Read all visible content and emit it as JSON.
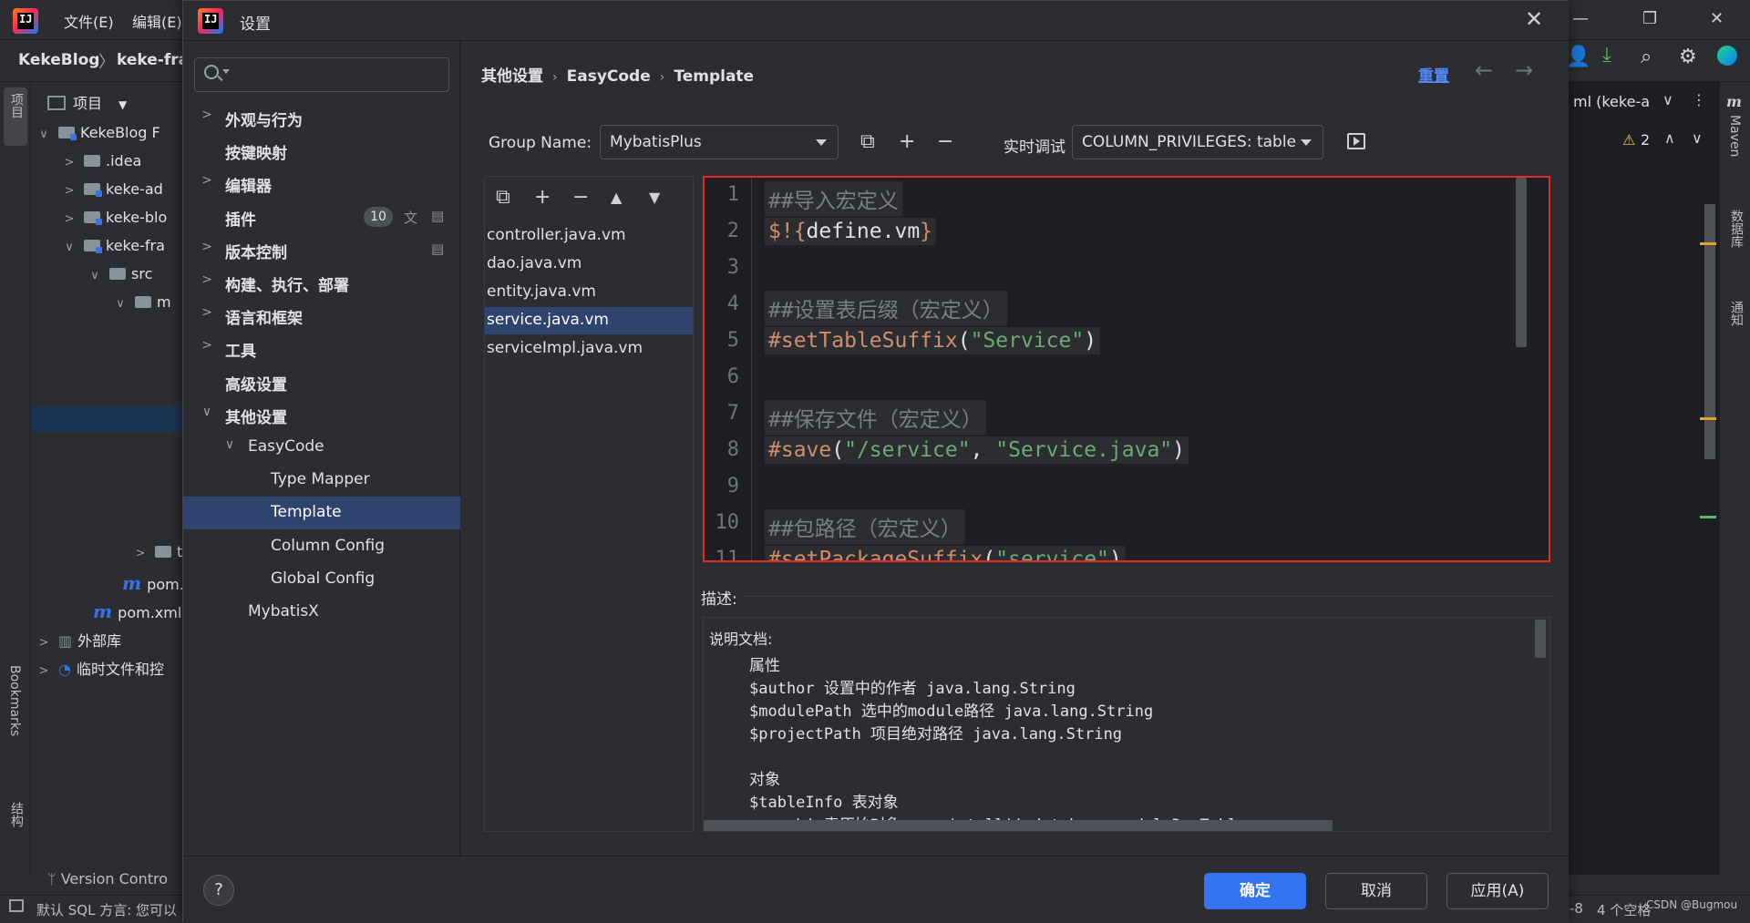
{
  "ide": {
    "menu": [
      "文件(E)",
      "编辑(E)"
    ],
    "breadcrumb": [
      "KekeBlog",
      "keke-fra"
    ],
    "project_label": "项目",
    "tree": [
      {
        "label": "KekeBlog F",
        "indent": 0,
        "type": "mod",
        "chev": "∨"
      },
      {
        "label": ".idea",
        "indent": 1,
        "type": "folder",
        "chev": ">"
      },
      {
        "label": "keke-ad",
        "indent": 1,
        "type": "mod",
        "chev": ">"
      },
      {
        "label": "keke-blo",
        "indent": 1,
        "type": "mod",
        "chev": ">"
      },
      {
        "label": "keke-fra",
        "indent": 1,
        "type": "mod",
        "chev": "∨"
      },
      {
        "label": "src",
        "indent": 2,
        "type": "folder",
        "chev": "∨"
      },
      {
        "label": "m",
        "indent": 3,
        "type": "folder",
        "chev": "∨"
      }
    ],
    "tree_bottom": [
      {
        "label": "te",
        "type": "folder"
      },
      {
        "label": "pom.",
        "type": "m"
      },
      {
        "label": "pom.xml",
        "type": "m"
      },
      {
        "label": "外部库",
        "type": "lib"
      },
      {
        "label": "临时文件和控",
        "type": "tmp"
      }
    ],
    "left_stripe": [
      "项目",
      "Bookmarks",
      "结构"
    ],
    "right_stripe": [
      "Maven",
      "数据库",
      "通知"
    ],
    "right_tab": "ml (keke-a",
    "warnings": "2",
    "bottom_tool": "Version Contro",
    "status_left": "默认 SQL 方言: 您可以",
    "status_right": [
      "-8",
      "4 个空格"
    ],
    "watermark": "CSDN @Bugmou"
  },
  "dialog": {
    "title": "设置",
    "nav": {
      "search_placeholder": "",
      "items": [
        {
          "label": "外观与行为",
          "level": 0,
          "chev": ">",
          "bold": true
        },
        {
          "label": "按键映射",
          "level": 0,
          "chev": "",
          "bold": true
        },
        {
          "label": "编辑器",
          "level": 0,
          "chev": ">",
          "bold": true
        },
        {
          "label": "插件",
          "level": 0,
          "chev": "",
          "bold": true,
          "badge": "10"
        },
        {
          "label": "版本控制",
          "level": 0,
          "chev": ">",
          "bold": true
        },
        {
          "label": "构建、执行、部署",
          "level": 0,
          "chev": ">",
          "bold": true
        },
        {
          "label": "语言和框架",
          "level": 0,
          "chev": ">",
          "bold": true
        },
        {
          "label": "工具",
          "level": 0,
          "chev": ">",
          "bold": true
        },
        {
          "label": "高级设置",
          "level": 0,
          "chev": "",
          "bold": true
        },
        {
          "label": "其他设置",
          "level": 0,
          "chev": "∨",
          "bold": true
        },
        {
          "label": "EasyCode",
          "level": 1,
          "chev": "∨",
          "bold": false
        },
        {
          "label": "Type Mapper",
          "level": 2,
          "chev": "",
          "bold": false
        },
        {
          "label": "Template",
          "level": 2,
          "chev": "",
          "bold": false,
          "selected": true
        },
        {
          "label": "Column Config",
          "level": 2,
          "chev": "",
          "bold": false
        },
        {
          "label": "Global Config",
          "level": 2,
          "chev": "",
          "bold": false
        },
        {
          "label": "MybatisX",
          "level": 1,
          "chev": "",
          "bold": false
        }
      ]
    },
    "breadcrumb": [
      "其他设置",
      "EasyCode",
      "Template"
    ],
    "reset_label": "重置",
    "group_name_label": "Group Name:",
    "group_name_value": "MybatisPlus",
    "debug_label": "实时调试",
    "debug_value": "COLUMN_PRIVILEGES: table",
    "files": [
      "controller.java.vm",
      "dao.java.vm",
      "entity.java.vm",
      "service.java.vm",
      "serviceImpl.java.vm"
    ],
    "selected_file": 3,
    "code_lines": [
      {
        "n": "1",
        "parts": [
          {
            "t": "##导入宏定义",
            "c": "comment"
          }
        ]
      },
      {
        "n": "2",
        "parts": [
          {
            "t": "$!{",
            "c": "directive"
          },
          {
            "t": "define.vm",
            "c": "ident"
          },
          {
            "t": "}",
            "c": "directive"
          }
        ]
      },
      {
        "n": "3",
        "parts": []
      },
      {
        "n": "4",
        "parts": [
          {
            "t": "##设置表后缀（宏定义）",
            "c": "comment"
          }
        ]
      },
      {
        "n": "5",
        "parts": [
          {
            "t": "#setTableSuffix",
            "c": "directive"
          },
          {
            "t": "(",
            "c": "ident"
          },
          {
            "t": "\"Service\"",
            "c": "str"
          },
          {
            "t": ")",
            "c": "ident"
          }
        ]
      },
      {
        "n": "6",
        "parts": []
      },
      {
        "n": "7",
        "parts": [
          {
            "t": "##保存文件（宏定义）",
            "c": "comment"
          }
        ]
      },
      {
        "n": "8",
        "parts": [
          {
            "t": "#save",
            "c": "directive"
          },
          {
            "t": "(",
            "c": "ident"
          },
          {
            "t": "\"/service\"",
            "c": "str"
          },
          {
            "t": ", ",
            "c": "ident"
          },
          {
            "t": "\"Service.java\"",
            "c": "str"
          },
          {
            "t": ")",
            "c": "ident"
          }
        ]
      },
      {
        "n": "9",
        "parts": []
      },
      {
        "n": "10",
        "parts": [
          {
            "t": "##包路径（宏定义）",
            "c": "comment"
          }
        ]
      },
      {
        "n": "11",
        "parts": [
          {
            "t": "#setPackageSuffix",
            "c": "directive"
          },
          {
            "t": "(",
            "c": "ident"
          },
          {
            "t": "\"service\"",
            "c": "str"
          },
          {
            "t": ")",
            "c": "ident"
          }
        ]
      }
    ],
    "desc_label": "描述:",
    "desc_title": "说明文档:",
    "desc_lines": [
      "属性",
      "$author 设置中的作者 java.lang.String",
      "$modulePath 选中的module路径 java.lang.String",
      "$projectPath 项目绝对路径 java.lang.String",
      "",
      "对象",
      "$tableInfo 表对象",
      "    obj 表原始对象 com.intellij.database.model.DasTable"
    ],
    "buttons": {
      "ok": "确定",
      "cancel": "取消",
      "apply": "应用(A)"
    },
    "help": "?"
  }
}
